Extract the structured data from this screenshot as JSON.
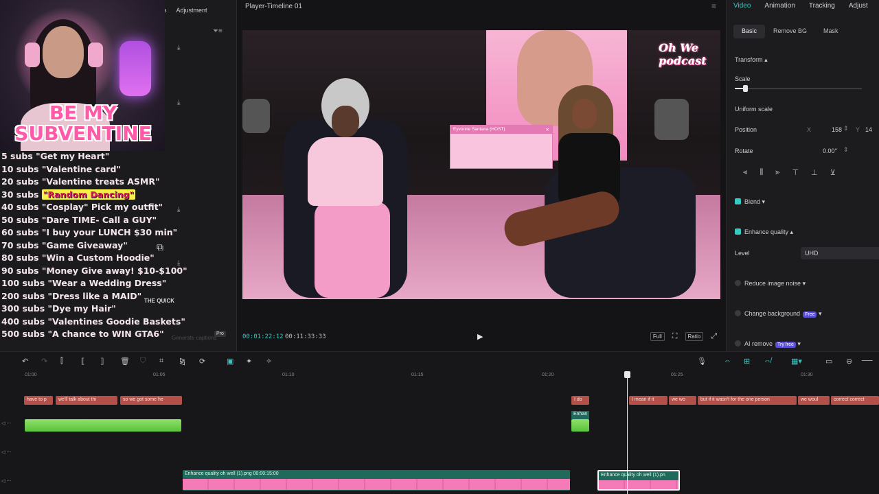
{
  "left_panel": {
    "tabs": [
      "ers",
      "Adjustment"
    ],
    "webcam_overlay": {
      "title": "BE MY SUBVENTINE",
      "goals": [
        {
          "subs": "5 subs",
          "text": "\"Get my Heart\""
        },
        {
          "subs": "10 subs",
          "text": "\"Valentine card\""
        },
        {
          "subs": "20 subs",
          "text": "\"Valentine treats ASMR\""
        },
        {
          "subs": "30 subs",
          "text": "\"Random Dancing\""
        },
        {
          "subs": "40 subs",
          "text": "\"Cosplay\" Pick my outfit\""
        },
        {
          "subs": "50 subs",
          "text": "\"Dare TIME- Call a GUY\""
        },
        {
          "subs": "60 subs",
          "text": "\"I buy your LUNCH $30 min\""
        },
        {
          "subs": "70 subs",
          "text": "\"Game Giveaway\""
        },
        {
          "subs": "80 subs",
          "text": "\"Win a Custom Hoodie\""
        },
        {
          "subs": "90 subs",
          "text": "\"Money Give away! $10-$100\""
        },
        {
          "subs": "100 subs",
          "text": "\"Wear a Wedding Dress\""
        },
        {
          "subs": "200 subs",
          "text": "\"Dress like a MAID\""
        },
        {
          "subs": "300 subs",
          "text": "\"Dye my Hair\""
        },
        {
          "subs": "400 subs",
          "text": "\"Valentines Goodie Baskets\""
        },
        {
          "subs": "500 subs",
          "text": "\"A chance to WIN GTA6\""
        }
      ]
    },
    "quick_logo": "THE QUICK",
    "pro_badge": "Pro",
    "generate_captions": "Generate captions"
  },
  "player": {
    "title": "Player-Timeline 01",
    "current_time": "00:01:22:12",
    "total_time": "00:11:33:33",
    "host_tag": "Eyvonne Santana (HOST)",
    "podcast_logo": "Oh We podcast",
    "controls": [
      "Full",
      "Ratio"
    ]
  },
  "inspector": {
    "tabs": [
      "Video",
      "Animation",
      "Tracking",
      "Adjust"
    ],
    "active_tab": "Video",
    "sub_tabs": [
      "Basic",
      "Remove BG",
      "Mask"
    ],
    "transform_label": "Transform",
    "scale_label": "Scale",
    "scale_value": 0.08,
    "uniform_scale_label": "Uniform scale",
    "position_label": "Position",
    "position_x_label": "X",
    "position_x": "158",
    "position_y_label": "Y",
    "position_y": "14",
    "rotate_label": "Rotate",
    "rotate_value": "0.00°",
    "blend_label": "Blend",
    "enhance_label": "Enhance quality",
    "level_label": "Level",
    "level_value": "UHD",
    "reduce_noise_label": "Reduce image noise",
    "change_bg_label": "Change background",
    "change_bg_badge": "Free",
    "ai_remove_label": "AI remove",
    "ai_remove_badge": "Try free"
  },
  "timeline": {
    "ruler_ticks": [
      "01:00",
      "01:05",
      "01:10",
      "01:15",
      "01:20",
      "01:25",
      "01:30"
    ],
    "captions": [
      "have to p",
      "we'll talk about thi",
      "so we got some he",
      "I do",
      "I mean if it",
      "we wo",
      "but if it wasn't for the one person",
      "we woul",
      "correct correct"
    ],
    "green_label": "Enhan",
    "main_clips": [
      {
        "label": "Enhance quality   oh well (1).png   00:00:15:00"
      },
      {
        "label": "Enhance quality   oh well (1).pn"
      }
    ]
  },
  "colors": {
    "accent": "#35c9c4",
    "caption_clip": "#b4504a",
    "video_clip": "#1f6a5a"
  }
}
